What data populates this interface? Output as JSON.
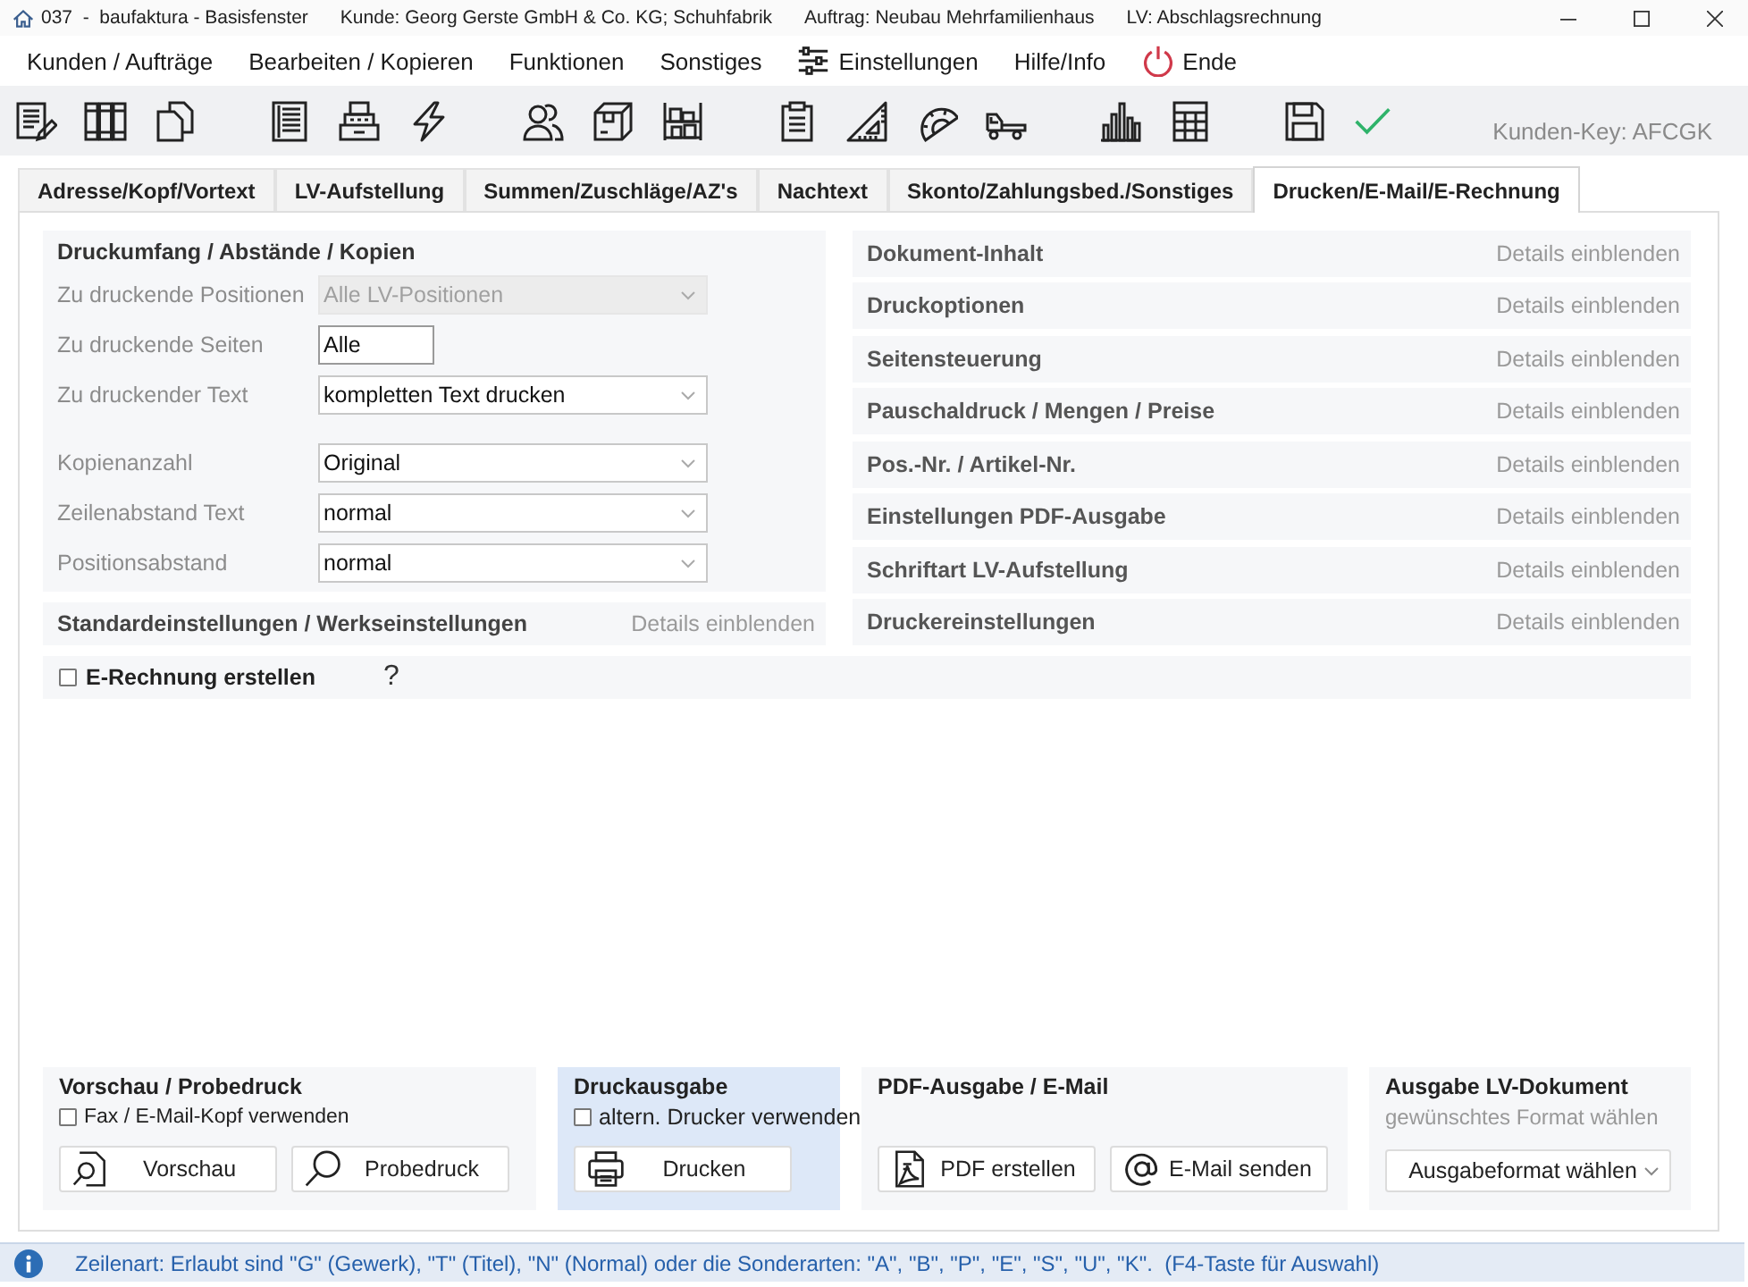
{
  "window": {
    "title_parts": [
      "037  -  baufaktura - Basisfenster",
      "Kunde: Georg Gerste GmbH & Co. KG; Schuhfabrik",
      "Auftrag: Neubau Mehrfamilienhaus",
      "LV: Abschlagsrechnung"
    ]
  },
  "menu": [
    {
      "label": "Kunden / Aufträge",
      "kind": "text"
    },
    {
      "label": "Bearbeiten / Kopieren",
      "kind": "text"
    },
    {
      "label": "Funktionen",
      "kind": "text"
    },
    {
      "label": "Sonstiges",
      "kind": "text"
    },
    {
      "label": "Einstellungen",
      "kind": "settings"
    },
    {
      "label": "Hilfe/Info",
      "kind": "text"
    },
    {
      "label": "Ende",
      "kind": "exit"
    }
  ],
  "toolbar": {
    "customer_key": "Kunden-Key: AFCGK"
  },
  "tabs": [
    {
      "label": "Adresse/Kopf/Vortext",
      "selected": false
    },
    {
      "label": "LV-Aufstellung",
      "selected": false
    },
    {
      "label": "Summen/Zuschläge/AZ's",
      "selected": false
    },
    {
      "label": "Nachtext",
      "selected": false
    },
    {
      "label": "Skonto/Zahlungsbed./Sonstiges",
      "selected": false
    },
    {
      "label": "Drucken/E-Mail/E-Rechnung",
      "selected": true
    }
  ],
  "print_scope": {
    "title": "Druckumfang / Abstände / Kopien",
    "field_groups": [
      [
        {
          "label": "Zu druckende Positionen",
          "kind": "select",
          "value": "Alle LV-Positionen",
          "disabled": true
        },
        {
          "label": "Zu druckende Seiten",
          "kind": "text",
          "value": "Alle",
          "disabled": false
        },
        {
          "label": "Zu druckender Text",
          "kind": "select",
          "value": "kompletten Text drucken",
          "disabled": false
        }
      ],
      [
        {
          "label": "Kopienanzahl",
          "kind": "select",
          "value": "Original",
          "disabled": false
        },
        {
          "label": "Zeilenabstand Text",
          "kind": "select",
          "value": "normal",
          "disabled": false
        },
        {
          "label": "Positionsabstand",
          "kind": "select",
          "value": "normal",
          "disabled": false
        }
      ]
    ]
  },
  "defaults_section": {
    "title": "Standardeinstellungen / Werkseinstellungen",
    "action": "Details einblenden"
  },
  "e_invoice": {
    "label": "E-Rechnung erstellen",
    "checked": false,
    "help": "?"
  },
  "sections": [
    {
      "title": "Dokument-Inhalt",
      "action": "Details einblenden"
    },
    {
      "title": "Druckoptionen",
      "action": "Details einblenden"
    },
    {
      "title": "Seitensteuerung",
      "action": "Details einblenden"
    },
    {
      "title": "Pauschaldruck / Mengen / Preise",
      "action": "Details einblenden"
    },
    {
      "title": "Pos.-Nr. / Artikel-Nr.",
      "action": "Details einblenden"
    },
    {
      "title": "Einstellungen PDF-Ausgabe",
      "action": "Details einblenden"
    },
    {
      "title": "Schriftart LV-Aufstellung",
      "action": "Details einblenden"
    },
    {
      "title": "Druckereinstellungen",
      "action": "Details einblenden"
    }
  ],
  "output_panels": [
    {
      "title": "Vorschau / Probedruck",
      "highlighted": false,
      "option": {
        "label": "Fax / E-Mail-Kopf verwenden",
        "checked": false
      },
      "buttons": [
        {
          "label": "Vorschau",
          "kind": "preview"
        },
        {
          "label": "Probedruck",
          "kind": "test-print"
        }
      ]
    },
    {
      "title": "Druckausgabe",
      "highlighted": true,
      "option": {
        "label": "altern. Drucker verwenden",
        "checked": false
      },
      "buttons": [
        {
          "label": "Drucken",
          "kind": "print"
        }
      ]
    },
    {
      "title": "PDF-Ausgabe / E-Mail",
      "highlighted": false,
      "buttons": [
        {
          "label": "PDF erstellen",
          "kind": "pdf"
        },
        {
          "label": "E-Mail senden",
          "kind": "email"
        }
      ]
    },
    {
      "title": "Ausgabe LV-Dokument",
      "highlighted": false,
      "hint": "gewünschtes Format wählen",
      "dropdown": {
        "value": "Ausgabeformat wählen"
      }
    }
  ],
  "status_bar": {
    "text": "Zeilenart: Erlaubt sind \"G\" (Gewerk), \"T\" (Titel), \"N\" (Normal) oder die Sonderarten: \"A\", \"B\", \"P\", \"E\", \"S\", \"U\", \"K\".  (F4-Taste für Auswahl)"
  }
}
